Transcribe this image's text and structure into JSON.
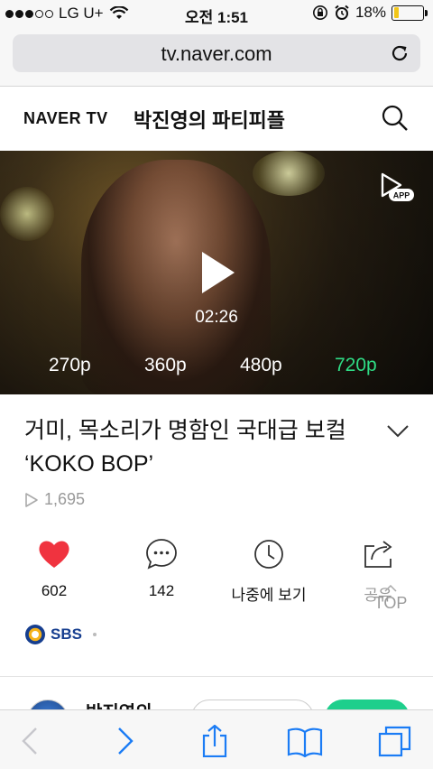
{
  "status_bar": {
    "carrier": "LG U+",
    "time": "오전 1:51",
    "battery": "18%",
    "signal_bars": 3,
    "battery_level": 0.18,
    "battery_color": "#f2c618"
  },
  "browser": {
    "url": "tv.naver.com",
    "reload_icon": "reload-icon"
  },
  "header": {
    "logo": "NAVER TV",
    "channel_title": "박진영의 파티피플",
    "search_icon": "search-icon"
  },
  "video": {
    "duration": "02:26",
    "app_badge": "APP",
    "qualities": [
      "270p",
      "360p",
      "480p",
      "720p"
    ],
    "selected_quality": "720p",
    "accent_color": "#2fdc85"
  },
  "clip": {
    "title_line1": "거미, 목소리가 명함인 국대급 보컬",
    "title_line2": "‘KOKO BOP’",
    "views": "1,695"
  },
  "actions": {
    "like_count": "602",
    "comment_count": "142",
    "watch_later": "나중에 보기",
    "share": "공유"
  },
  "top_button": "TOP",
  "broadcaster": "SBS",
  "channel_row": {
    "name": "박진영의"
  },
  "colors": {
    "like_red": "#f0333f",
    "follow_green": "#1ecf8c",
    "ios_blue": "#1b7cf5"
  }
}
